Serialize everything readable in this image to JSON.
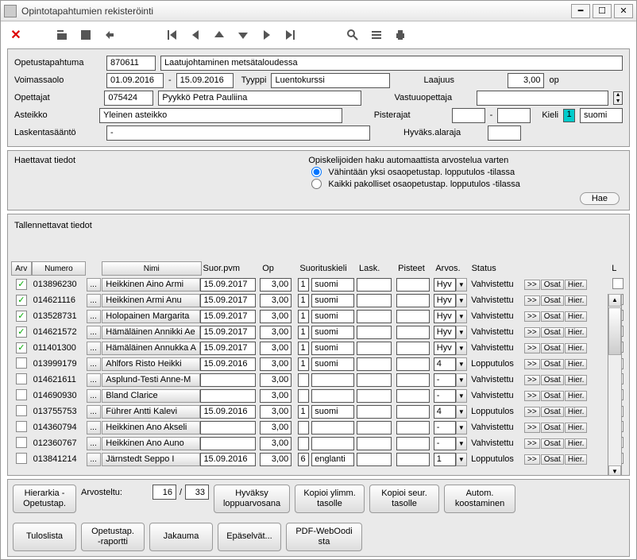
{
  "window": {
    "title": "Opintotapahtumien rekisteröinti"
  },
  "top": {
    "opetustapahtuma_lbl": "Opetustapahtuma",
    "opetustapahtuma_code": "870611",
    "opetustapahtuma_name": "Laatujohtaminen metsätaloudessa",
    "voimassaolo_lbl": "Voimassaolo",
    "voimassa_from": "01.09.2016",
    "voimassa_to": "15.09.2016",
    "tyyppi_lbl": "Tyyppi",
    "tyyppi_val": "Luentokurssi",
    "laajuus_lbl": "Laajuus",
    "laajuus_val": "3,00",
    "op_lbl": "op",
    "opettajat_lbl": "Opettajat",
    "opettajat_code": "075424",
    "opettajat_name": "Pyykkö Petra Pauliina",
    "vastuu_lbl": "Vastuuopettaja",
    "asteikko_lbl": "Asteikko",
    "asteikko_val": "Yleinen asteikko",
    "pisterajat_lbl": "Pisterajat",
    "pisterajat_from": "",
    "pisterajat_to": "",
    "kieli_lbl": "Kieli",
    "kieli_num": "1",
    "kieli_val": "suomi",
    "laskenta_lbl": "Laskentasääntö",
    "laskenta_val": "-",
    "hyvaks_lbl": "Hyväks.alaraja",
    "hyvaks_val": ""
  },
  "search": {
    "haettavat_lbl": "Haettavat tiedot",
    "autom_lbl": "Opiskelijoiden haku automaattista arvostelua varten",
    "opt1": "Vähintään yksi osaopetustap. lopputulos -tilassa",
    "opt2": "Kaikki pakolliset osaopetustap. lopputulos -tilassa",
    "hae": "Hae"
  },
  "table": {
    "title": "Tallennettavat tiedot",
    "headers": {
      "arv": "Arv",
      "numero": "Numero",
      "nimi": "Nimi",
      "suor": "Suor.pvm",
      "op": "Op",
      "sk": "Suorituskieli",
      "lask": "Lask.",
      "pist": "Pisteet",
      "arvos": "Arvos.",
      "status": "Status",
      "l": "L"
    },
    "rows": [
      {
        "chk": true,
        "num": "013896230",
        "name": "Heikkinen Aino Armi",
        "date": "15.09.2017",
        "op": "3,00",
        "sk1": "1",
        "sk2": "suomi",
        "lask": "",
        "pist": "",
        "arvos": "Hyv",
        "status": "Vahvistettu",
        "l": false
      },
      {
        "chk": true,
        "num": "014621116",
        "name": "Heikkinen Armi Anu",
        "date": "15.09.2017",
        "op": "3,00",
        "sk1": "1",
        "sk2": "suomi",
        "lask": "",
        "pist": "",
        "arvos": "Hyv",
        "status": "Vahvistettu",
        "l": false
      },
      {
        "chk": true,
        "num": "013528731",
        "name": "Holopainen Margarita ",
        "date": "15.09.2017",
        "op": "3,00",
        "sk1": "1",
        "sk2": "suomi",
        "lask": "",
        "pist": "",
        "arvos": "Hyv",
        "status": "Vahvistettu",
        "l": false
      },
      {
        "chk": true,
        "num": "014621572",
        "name": "Hämäläinen Annikki Ae",
        "date": "15.09.2017",
        "op": "3,00",
        "sk1": "1",
        "sk2": "suomi",
        "lask": "",
        "pist": "",
        "arvos": "Hyv",
        "status": "Vahvistettu",
        "l": false
      },
      {
        "chk": true,
        "num": "011401300",
        "name": "Hämäläinen Annukka A",
        "date": "15.09.2017",
        "op": "3,00",
        "sk1": "1",
        "sk2": "suomi",
        "lask": "",
        "pist": "",
        "arvos": "Hyv",
        "status": "Vahvistettu",
        "l": false
      },
      {
        "chk": false,
        "num": "013999179",
        "name": "Ahlfors Risto Heikki",
        "date": "15.09.2016",
        "op": "3,00",
        "sk1": "1",
        "sk2": "suomi",
        "lask": "",
        "pist": "",
        "arvos": "4",
        "status": "Lopputulos",
        "l": true
      },
      {
        "chk": false,
        "num": "014621611",
        "name": "Asplund-Testi Anne-M",
        "date": "",
        "op": "3,00",
        "sk1": "",
        "sk2": "",
        "lask": "",
        "pist": "",
        "arvos": "-",
        "status": "Vahvistettu",
        "l": false
      },
      {
        "chk": false,
        "num": "014690930",
        "name": "Bland Clarice",
        "date": "",
        "op": "3,00",
        "sk1": "",
        "sk2": "",
        "lask": "",
        "pist": "",
        "arvos": "-",
        "status": "Vahvistettu",
        "l": false
      },
      {
        "chk": false,
        "num": "013755753",
        "name": "Führer Antti Kalevi",
        "date": "15.09.2016",
        "op": "3,00",
        "sk1": "1",
        "sk2": "suomi",
        "lask": "",
        "pist": "",
        "arvos": "4",
        "status": "Lopputulos",
        "l": true
      },
      {
        "chk": false,
        "num": "014360794",
        "name": "Heikkinen Ano Akseli",
        "date": "",
        "op": "3,00",
        "sk1": "",
        "sk2": "",
        "lask": "",
        "pist": "",
        "arvos": "-",
        "status": "Vahvistettu",
        "l": false
      },
      {
        "chk": false,
        "num": "012360767",
        "name": "Heikkinen Ano Auno",
        "date": "",
        "op": "3,00",
        "sk1": "",
        "sk2": "",
        "lask": "",
        "pist": "",
        "arvos": "-",
        "status": "Vahvistettu",
        "l": false
      },
      {
        "chk": false,
        "num": "013841214",
        "name": "Järnstedt Seppo I",
        "date": "15.09.2016",
        "op": "3,00",
        "sk1": "6",
        "sk2": "englanti",
        "lask": "",
        "pist": "",
        "arvos": "1",
        "status": "Lopputulos",
        "l": false
      }
    ],
    "actions": {
      "expand": "...",
      "go": ">>",
      "osat": "Osat",
      "hier": "Hier."
    }
  },
  "bottom": {
    "hierarkia": "Hierarkia -\nOpetustap.",
    "arvosteltu_lbl": "Arvosteltu:",
    "arv_a": "16",
    "arv_sep": "/",
    "arv_b": "33",
    "hyvaksy": "Hyväksy\nloppuarvosana",
    "kopioi1": "Kopioi ylimm.\ntasolle",
    "kopioi2": "Kopioi seur.\ntasolle",
    "autom": "Autom.\nkoostaminen",
    "tuloslista": "Tuloslista",
    "raportti": "Opetustap.\n-raportti",
    "jakauma": "Jakauma",
    "epaselvat": "Epäselvät...",
    "pdf": "PDF-WebOodi\nsta"
  }
}
